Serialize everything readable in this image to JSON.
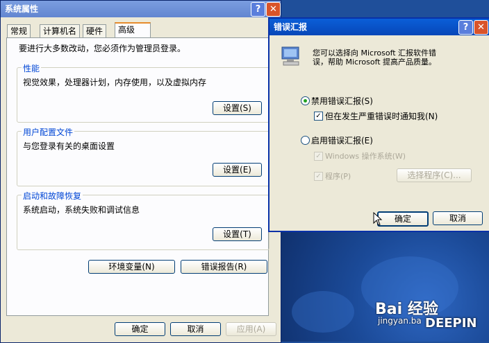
{
  "main_window": {
    "title": "系统属性",
    "help_glyph": "?",
    "close_glyph": "✕",
    "tabs": [
      "常规",
      "计算机名",
      "硬件",
      "高级"
    ],
    "intro": "要进行大多数改动，您必须作为管理员登录。",
    "performance": {
      "label": "性能",
      "desc": "视觉效果，处理器计划，内存使用，以及虚拟内存",
      "button": "设置(S)"
    },
    "profiles": {
      "label": "用户配置文件",
      "desc": "与您登录有关的桌面设置",
      "button": "设置(E)"
    },
    "startup": {
      "label": "启动和故障恢复",
      "desc": "系统启动，系统失败和调试信息",
      "button": "设置(T)"
    },
    "env_button": "环境变量(N)",
    "error_report_button": "错误报告(R)",
    "ok": "确定",
    "cancel": "取消",
    "apply": "应用(A)"
  },
  "error_dialog": {
    "title": "错误汇报",
    "help_glyph": "?",
    "close_glyph": "✕",
    "message_line1": "您可以选择向 Microsoft 汇报软件错",
    "message_line2": "误，帮助 Microsoft 提高产品质量。",
    "disable_option": "禁用错误汇报(S)",
    "notify_critical": "但在发生严重错误时通知我(N)",
    "enable_option": "启用错误汇报(E)",
    "windows_os": "Windows 操作系统(W)",
    "programs": "程序(P)",
    "choose_programs": "选择程序(C)...",
    "ok": "确定",
    "cancel": "取消",
    "selected": "disable"
  },
  "watermark": {
    "brand": "Bai 经验",
    "domain": "jingyan.ba",
    "deepin": "DEEPIN"
  },
  "colors": {
    "accent_tab": "#e68b2c",
    "group_label": "#0046d5",
    "title_active": "#0a5fd8"
  }
}
